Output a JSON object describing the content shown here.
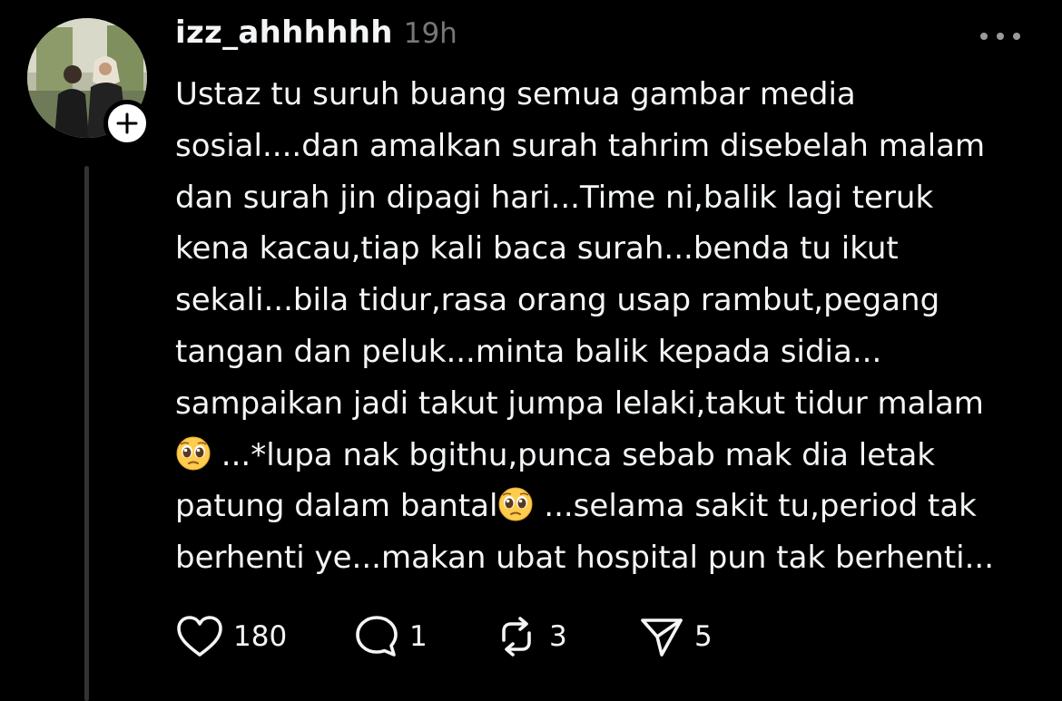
{
  "post": {
    "username": "izz_ahhhhhh",
    "time": "19h",
    "more_icon": "ellipsis-icon",
    "avatar_icon": "profile-photo",
    "follow_icon": "plus-icon",
    "body_lines": [
      "Ustaz tu suruh buang semua gambar media",
      "sosial....dan amalkan surah tahrim disebelah malam",
      "dan surah jin dipagi hari...Time ni,balik lagi teruk",
      "kena kacau,tiap kali baca surah...benda tu ikut",
      "sekali...bila tidur,rasa orang usap rambut,pegang",
      "tangan dan peluk...minta balik kepada sidia...",
      "sampaikan jadi takut jumpa lelaki,takut tidur malam"
    ],
    "line8_text": " ...*lupa nak bgithu,punca sebab mak dia letak",
    "line9_text_before": "patung dalam bantal",
    "line9_text_after": " ...selama sakit tu,period tak",
    "line10_text": "berhenti ye...makan ubat hospital pun tak berhenti...",
    "emoji_icon": "pleading-face-emoji"
  },
  "actions": {
    "like": {
      "icon": "heart-icon",
      "count": "180"
    },
    "reply": {
      "icon": "comment-bubble-icon",
      "count": "1"
    },
    "repost": {
      "icon": "repost-icon",
      "count": "3"
    },
    "share": {
      "icon": "send-icon",
      "count": "5"
    }
  },
  "colors": {
    "background": "#000000",
    "text": "#f3f5f7",
    "muted": "#777777",
    "thread_line": "#333333"
  }
}
